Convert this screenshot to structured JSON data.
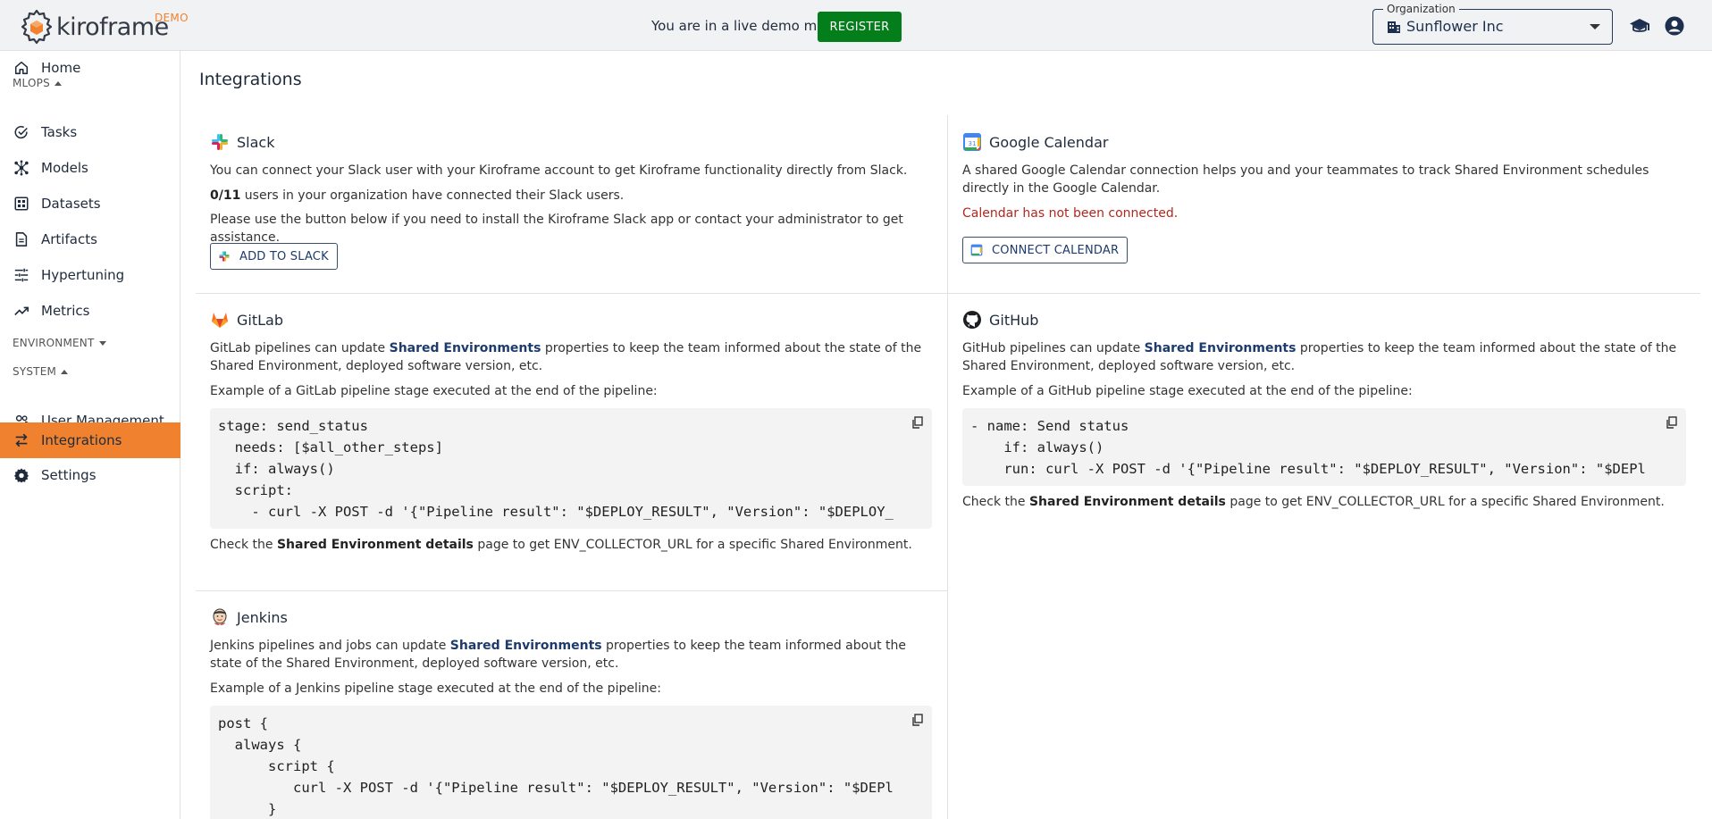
{
  "header": {
    "logo_text": "kiroframe",
    "demo_tag": "DEMO",
    "demo_message": "You are in a live demo mode",
    "register_label": "REGISTER",
    "organization_label": "Organization",
    "organization_value": "Sunflower Inc"
  },
  "sidebar": {
    "home": "Home",
    "section_mlops": "MLOPS",
    "tasks": "Tasks",
    "models": "Models",
    "datasets": "Datasets",
    "artifacts": "Artifacts",
    "hypertuning": "Hypertuning",
    "metrics": "Metrics",
    "section_environment": "ENVIRONMENT",
    "section_system": "SYSTEM",
    "user_management": "User Management",
    "integrations": "Integrations",
    "settings": "Settings"
  },
  "page": {
    "title": "Integrations"
  },
  "slack": {
    "title": "Slack",
    "line1": "You can connect your Slack user with your Kiroframe account to get Kiroframe functionality directly from Slack.",
    "count": "0/11",
    "line2_rest": " users in your organization have connected their Slack users.",
    "line3": "Please use the button below if you need to install the Kiroframe Slack app or contact your administrator to get assistance.",
    "button": "ADD TO SLACK"
  },
  "calendar": {
    "title": "Google Calendar",
    "line1": "A shared Google Calendar connection helps you and your teammates to track Shared Environment schedules directly in the Google Calendar.",
    "status": "Calendar has not been connected.",
    "button": "CONNECT CALENDAR"
  },
  "gitlab": {
    "title": "GitLab",
    "desc_before": "GitLab pipelines can update ",
    "desc_link": "Shared Environments",
    "desc_after": " properties to keep the team informed about the state of the Shared Environment, deployed software version, etc.",
    "example": "Example of a GitLab pipeline stage executed at the end of the pipeline:",
    "code": "stage: send_status\n  needs: [$all_other_steps]\n  if: always()\n  script:\n    - curl -X POST -d '{\"Pipeline result\": \"$DEPLOY_RESULT\", \"Version\": \"$DEPLOY_",
    "footer_before": "Check the ",
    "footer_bold": "Shared Environment details",
    "footer_after": " page to get ENV_COLLECTOR_URL for a specific Shared Environment."
  },
  "github": {
    "title": "GitHub",
    "desc_before": "GitHub pipelines can update ",
    "desc_link": "Shared Environments",
    "desc_after": " properties to keep the team informed about the state of the Shared Environment, deployed software version, etc.",
    "example": "Example of a GitHub pipeline stage executed at the end of the pipeline:",
    "code": "- name: Send status\n    if: always()\n    run: curl -X POST -d '{\"Pipeline result\": \"$DEPLOY_RESULT\", \"Version\": \"$DEPl",
    "footer_before": "Check the ",
    "footer_bold": "Shared Environment details",
    "footer_after": " page to get ENV_COLLECTOR_URL for a specific Shared Environment."
  },
  "jenkins": {
    "title": "Jenkins",
    "desc_before": "Jenkins pipelines and jobs can update ",
    "desc_link": "Shared Environments",
    "desc_after": " properties to keep the team informed about the state of the Shared Environment, deployed software version, etc.",
    "example": "Example of a Jenkins pipeline stage executed at the end of the pipeline:",
    "code": "post {\n  always {\n      script {\n         curl -X POST -d '{\"Pipeline result\": \"$DEPLOY_RESULT\", \"Version\": \"$DEPl\n      }"
  },
  "colors": {
    "accent": "#f0822f",
    "register": "#047d1b",
    "link": "#1d3b6b",
    "error": "#b3261e"
  }
}
